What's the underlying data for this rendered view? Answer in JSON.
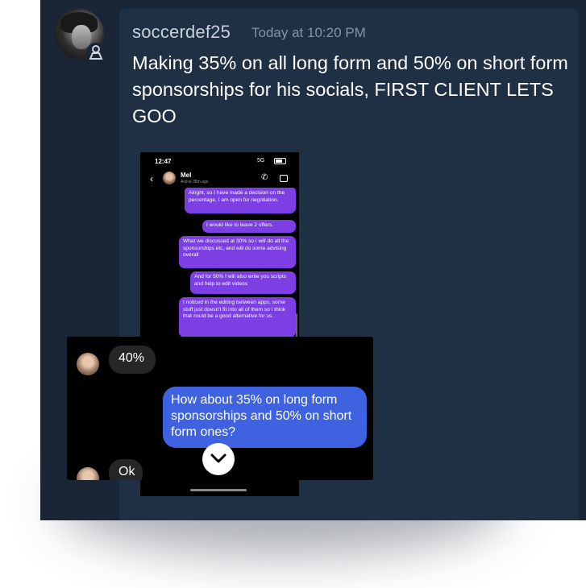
{
  "message": {
    "username": "soccerdef25",
    "timestamp": "Today at 10:20 PM",
    "text": "Making 35% on all long form and 50% on short form sponsorships for his socials, FIRST CLIENT LETS GOO"
  },
  "attachment": {
    "status_time": "12:47",
    "status_signal": "5G",
    "contact_name": "Mel",
    "contact_status": "Active 38m ago",
    "messages": [
      "Alright, so I have made a decision on the percentage, I am open for negotiation.",
      "I would like to leave 2 offers.",
      "What we discussed at 30% so I will do all the sponsorships etc, and will do some advising overall",
      "And for 50% I will also write you scripts and help to edit videos",
      "I noticed in the editing between apps, some stuff just doesn't fit into all of them so I think that could be a good alternative for us."
    ]
  },
  "zoom": {
    "received_1": "40%",
    "sent": "How about 35% on long form sponsorships and 50% on short form ones?",
    "received_2": "Ok"
  },
  "icons": {
    "avatar_badge": "user-icon",
    "back": "chevron-left-icon",
    "call": "phone-icon",
    "video": "video-icon",
    "scroll_down": "chevron-down-icon"
  },
  "colors": {
    "background": "#1a2636",
    "card": "#1f2f44",
    "username": "#c7d0db",
    "timestamp": "#8593a4",
    "dm_purple": "#7b3fe4",
    "dm_blue": "#3f63e0"
  }
}
